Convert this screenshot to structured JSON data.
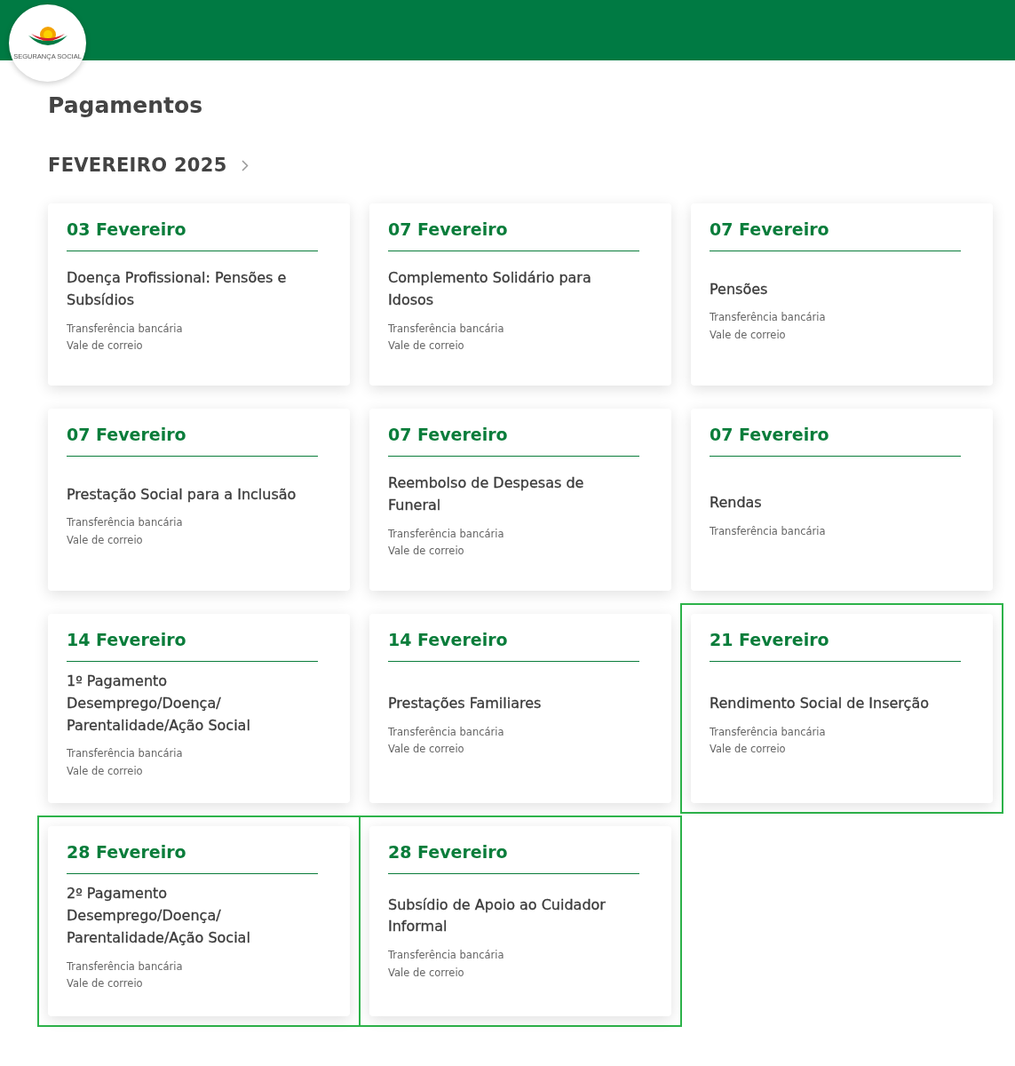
{
  "logo": {
    "text": "SEGURANÇA SOCIAL"
  },
  "title": "Pagamentos",
  "month": {
    "label": "FEVEREIRO 2025"
  },
  "cards": [
    {
      "date": "03 Fevereiro",
      "title": "Doença Profissional: Pensões e Subsídios",
      "methods": [
        "Transferência bancária",
        "Vale de correio"
      ],
      "highlighted": false
    },
    {
      "date": "07 Fevereiro",
      "title": "Complemento Solidário para Idosos",
      "methods": [
        "Transferência bancária",
        "Vale de correio"
      ],
      "highlighted": false
    },
    {
      "date": "07 Fevereiro",
      "title": "Pensões",
      "methods": [
        "Transferência bancária",
        "Vale de correio"
      ],
      "highlighted": false
    },
    {
      "date": "07 Fevereiro",
      "title": "Prestação Social para a Inclusão",
      "methods": [
        "Transferência bancária",
        "Vale de correio"
      ],
      "highlighted": false
    },
    {
      "date": "07 Fevereiro",
      "title": "Reembolso de Despesas de Funeral",
      "methods": [
        "Transferência bancária",
        "Vale de correio"
      ],
      "highlighted": false
    },
    {
      "date": "07 Fevereiro",
      "title": "Rendas",
      "methods": [
        "Transferência bancária"
      ],
      "highlighted": false
    },
    {
      "date": "14 Fevereiro",
      "title": "1º Pagamento Desemprego/Doença/ Parentalidade/Ação Social",
      "methods": [
        "Transferência bancária",
        "Vale de correio"
      ],
      "highlighted": false
    },
    {
      "date": "14 Fevereiro",
      "title": "Prestações Familiares",
      "methods": [
        "Transferência bancária",
        "Vale de correio"
      ],
      "highlighted": false
    },
    {
      "date": "21 Fevereiro",
      "title": "Rendimento Social de Inserção",
      "methods": [
        "Transferência bancária",
        "Vale de correio"
      ],
      "highlighted": true
    },
    {
      "date": "28 Fevereiro",
      "title": "2º Pagamento Desemprego/Doença/ Parentalidade/Ação Social",
      "methods": [
        "Transferência bancária",
        "Vale de correio"
      ],
      "highlighted": true
    },
    {
      "date": "28 Fevereiro",
      "title": "Subsídio de Apoio ao Cuidador Informal",
      "methods": [
        "Transferência bancária",
        "Vale de correio"
      ],
      "highlighted": true
    }
  ]
}
